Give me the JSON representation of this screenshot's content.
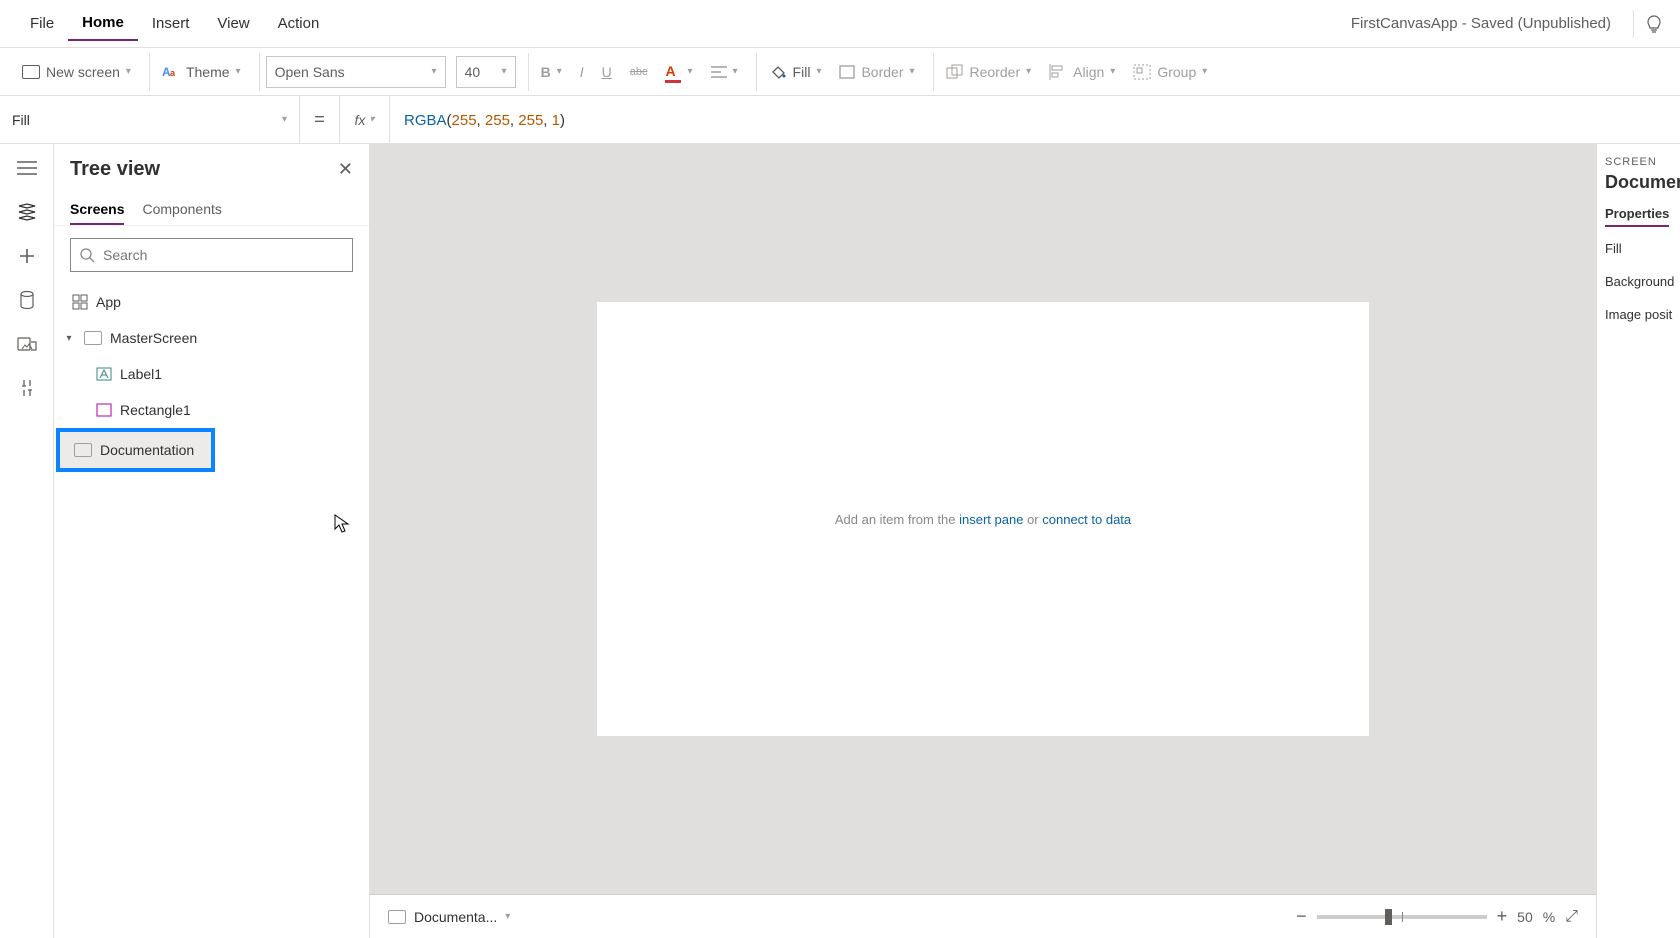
{
  "header": {
    "menus": [
      "File",
      "Home",
      "Insert",
      "View",
      "Action"
    ],
    "active_menu": "Home",
    "app_title": "FirstCanvasApp - Saved (Unpublished)"
  },
  "ribbon": {
    "new_screen": "New screen",
    "theme": "Theme",
    "font_name": "Open Sans",
    "font_size": "40",
    "fill": "Fill",
    "border": "Border",
    "reorder": "Reorder",
    "align": "Align",
    "group": "Group"
  },
  "formula": {
    "property": "Fill",
    "eq": "=",
    "fx": "fx",
    "fn": "RGBA",
    "open": "(",
    "a1": "255",
    "c": ", ",
    "a2": "255",
    "a3": "255",
    "a4": "1",
    "close": ")"
  },
  "tree": {
    "title": "Tree view",
    "tabs": {
      "screens": "Screens",
      "components": "Components"
    },
    "search_placeholder": "Search",
    "items": {
      "app": "App",
      "master": "MasterScreen",
      "label1": "Label1",
      "rect1": "Rectangle1",
      "doc": "Documentation"
    },
    "more": "· · ·"
  },
  "canvas": {
    "hint_prefix": "Add an item from the ",
    "hint_link1": "insert pane",
    "hint_mid": " or ",
    "hint_link2": "connect to data"
  },
  "status": {
    "screen_name": "Documenta...",
    "zoom_value": "50",
    "zoom_pct": "%"
  },
  "right_panel": {
    "label": "SCREEN",
    "name": "Document",
    "tab": "Properties",
    "rows": [
      "Fill",
      "Background",
      "Image posit"
    ]
  }
}
